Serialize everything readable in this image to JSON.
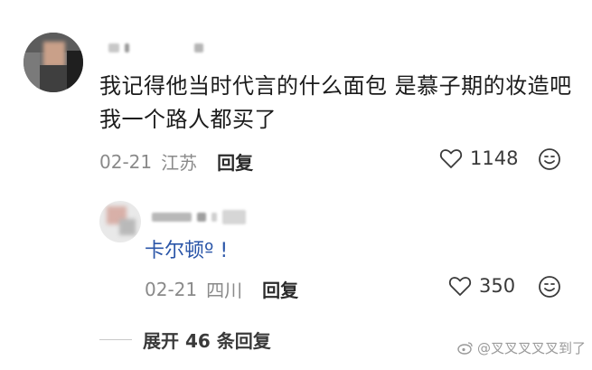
{
  "comment": {
    "text_line1": "我记得他当时代言的什么面包 是慕子期的妆造吧",
    "text_line2": "我一个路人都买了",
    "date": "02-21",
    "location": "江苏",
    "reply_label": "回复",
    "like_count": "1148"
  },
  "reply": {
    "text": "卡尔顿",
    "suffix": "º !",
    "date": "02-21",
    "location": "四川",
    "reply_label": "回复",
    "like_count": "350"
  },
  "expand_label": "展开 46 条回复",
  "watermark": "@叉叉叉叉叉到了",
  "colors": {
    "link_blue": "#2a55a8",
    "meta_gray": "#8a8a8a",
    "text_dark": "#1b1b1b"
  },
  "icons": {
    "like": "heart-outline-icon",
    "emoji": "emoji-face-icon",
    "weibo": "weibo-icon"
  }
}
